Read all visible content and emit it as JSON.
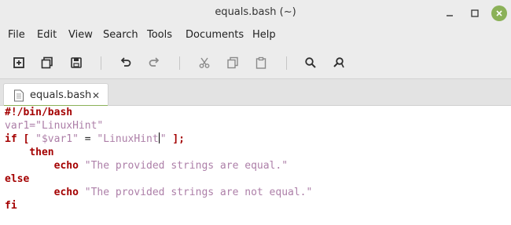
{
  "window": {
    "title": "equals.bash (~)",
    "accent_color": "#8bb158",
    "controls": [
      "minimize-icon",
      "maximize-icon",
      "close-icon"
    ]
  },
  "menu": {
    "items": [
      "File",
      "Edit",
      "View",
      "Search",
      "Tools",
      "Documents",
      "Help"
    ]
  },
  "toolbar": {
    "buttons": [
      "new-document-icon",
      "open-icon",
      "save-icon",
      "undo-icon",
      "redo-icon",
      "cut-icon",
      "copy-icon",
      "paste-icon",
      "find-icon",
      "find-replace-icon"
    ]
  },
  "tabs": [
    {
      "label": "equals.bash",
      "active": true,
      "close_glyph": "✕"
    }
  ],
  "editor": {
    "lines": [
      [
        {
          "t": "#!/bin/bash",
          "c": "kw"
        }
      ],
      [
        {
          "t": "var1=",
          "c": "str"
        },
        {
          "t": "\"LinuxHint\"",
          "c": "str"
        }
      ],
      [
        {
          "t": "if [ ",
          "c": "kw"
        },
        {
          "t": "\"$var1\"",
          "c": "str"
        },
        {
          "t": " = ",
          "c": "plain"
        },
        {
          "t": "\"LinuxHint",
          "c": "str"
        },
        {
          "t": "|",
          "c": "cursor"
        },
        {
          "t": "\"",
          "c": "str"
        },
        {
          "t": " ];",
          "c": "kw"
        }
      ],
      [
        {
          "t": "    then",
          "c": "kw"
        }
      ],
      [
        {
          "t": "        echo",
          "c": "kw"
        },
        {
          "t": " \"The provided strings are equal.\"",
          "c": "str"
        }
      ],
      [
        {
          "t": "else",
          "c": "kw"
        }
      ],
      [
        {
          "t": "        echo",
          "c": "kw"
        },
        {
          "t": " \"The provided strings are not equal.\"",
          "c": "str"
        }
      ],
      [
        {
          "t": "fi",
          "c": "kw"
        }
      ]
    ]
  },
  "colors": {
    "keyword": "#a40000",
    "string": "#ad7fa8",
    "chrome": "#ececec"
  }
}
